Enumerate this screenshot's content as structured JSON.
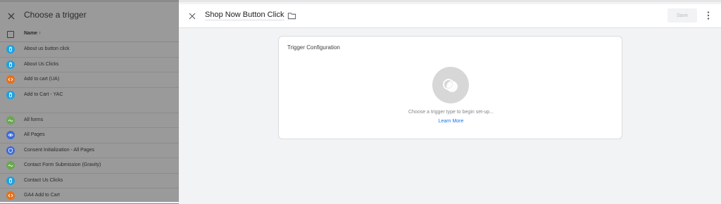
{
  "picker": {
    "title": "Choose a trigger",
    "column_name": "Name ↑",
    "items": [
      {
        "label": "About us button click",
        "icon": "click-icon",
        "color": "#1ba1e2"
      },
      {
        "label": "About Us Clicks",
        "icon": "click-icon",
        "color": "#1ba1e2"
      },
      {
        "label": "Add to cart (UA)",
        "icon": "code-icon",
        "color": "#e2711d"
      },
      {
        "label": "Add to Cart - YAC",
        "icon": "click-icon",
        "color": "#1ba1e2"
      },
      {
        "label": "All forms",
        "icon": "form-icon",
        "color": "#6aa84f"
      },
      {
        "label": "All Pages",
        "icon": "eye-icon",
        "color": "#3d6bd6"
      },
      {
        "label": "Consent Initialization - All Pages",
        "icon": "shield-icon",
        "color": "#3d6bd6"
      },
      {
        "label": "Contact Form Submission (Gravity)",
        "icon": "form-icon",
        "color": "#6aa84f"
      },
      {
        "label": "Contact Us Clicks",
        "icon": "click-icon",
        "color": "#1ba1e2"
      },
      {
        "label": "GA4 Add to Cart",
        "icon": "code-icon",
        "color": "#e2711d"
      }
    ]
  },
  "editor": {
    "tag_name": "Shop Now Button Click",
    "save_label": "Save",
    "card_title": "Trigger Configuration",
    "hint": "Choose a trigger type to begin set-up...",
    "learn_more": "Learn More"
  }
}
